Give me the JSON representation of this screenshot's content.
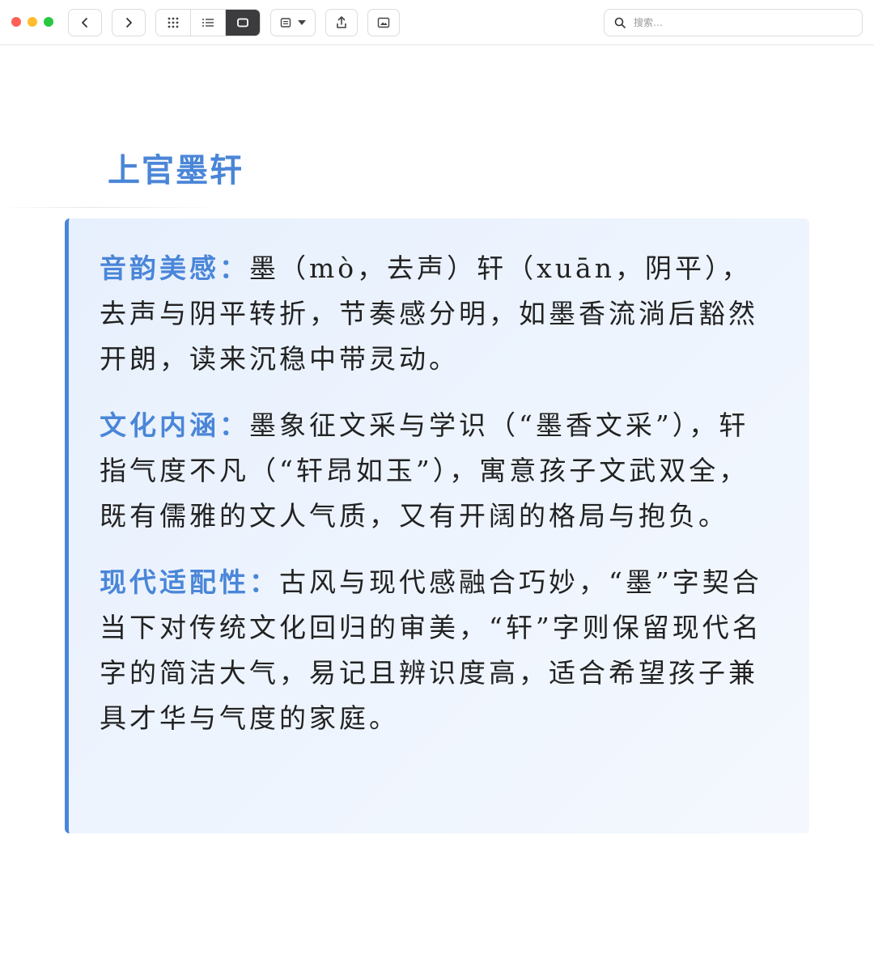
{
  "toolbar": {
    "back_icon": "chevron-left-icon",
    "forward_icon": "chevron-right-icon",
    "view_modes": [
      {
        "icon": "grid-icon",
        "active": false
      },
      {
        "icon": "list-icon",
        "active": false
      },
      {
        "icon": "single-page-icon",
        "active": true
      }
    ],
    "format_icon": "text-format-icon",
    "share_icon": "share-icon",
    "image_icon": "image-icon",
    "search_placeholder": "搜索…"
  },
  "content": {
    "title": "上官墨轩",
    "sections": [
      {
        "label": "音韵美感",
        "separator": "：",
        "text": "墨（mò，去声）轩（xuān，阴平），去声与阴平转折，节奏感分明，如墨香流淌后豁然开朗，读来沉稳中带灵动。"
      },
      {
        "label": "文化内涵",
        "separator": "：",
        "text": "墨象征文采与学识（“墨香文采”），轩指气度不凡（“轩昂如玉”），寓意孩子文武双全，既有儒雅的文人气质，又有开阔的格局与抱负。"
      },
      {
        "label": "现代适配性",
        "separator": "：",
        "text": "古风与现代感融合巧妙，“墨”字契合当下对传统文化回归的审美，“轩”字则保留现代名字的简洁大气，易记且辨识度高，适合希望孩子兼具才华与气度的家庭。"
      }
    ]
  },
  "colors": {
    "accent": "#4a86d8",
    "card_bg": "#eaf2fd",
    "text": "#222222"
  }
}
